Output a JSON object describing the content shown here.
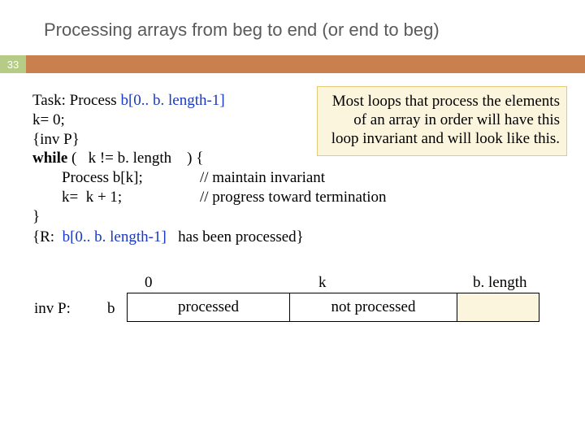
{
  "slide": {
    "title": "Processing arrays from beg to end (or end to beg)",
    "number": "33"
  },
  "callout": {
    "text": "Most loops that process the elements of an array in order will have this loop invariant and will look like this."
  },
  "code": {
    "task_prefix": "Task: Process ",
    "task_range": "b[0.. b. length-1]",
    "init": "k= 0;",
    "inv": "{inv P}",
    "while_kw": "while",
    "while_open": " (   ",
    "while_cond": "k != b. length",
    "while_close": "    ) {",
    "body1": "Process b[k];",
    "comment1": "// maintain invariant",
    "body2": "k=  k + 1;",
    "comment2": "// progress toward termination",
    "close_brace": "}",
    "post_prefix": "{R:  ",
    "post_range": "b[0.. b. length-1]",
    "post_suffix": "   has been processed}"
  },
  "diagram": {
    "label_0": "0",
    "label_k": "k",
    "label_blen": "b. length",
    "invp": "inv P:",
    "arr": "b",
    "processed": "processed",
    "not_processed": "not processed"
  }
}
